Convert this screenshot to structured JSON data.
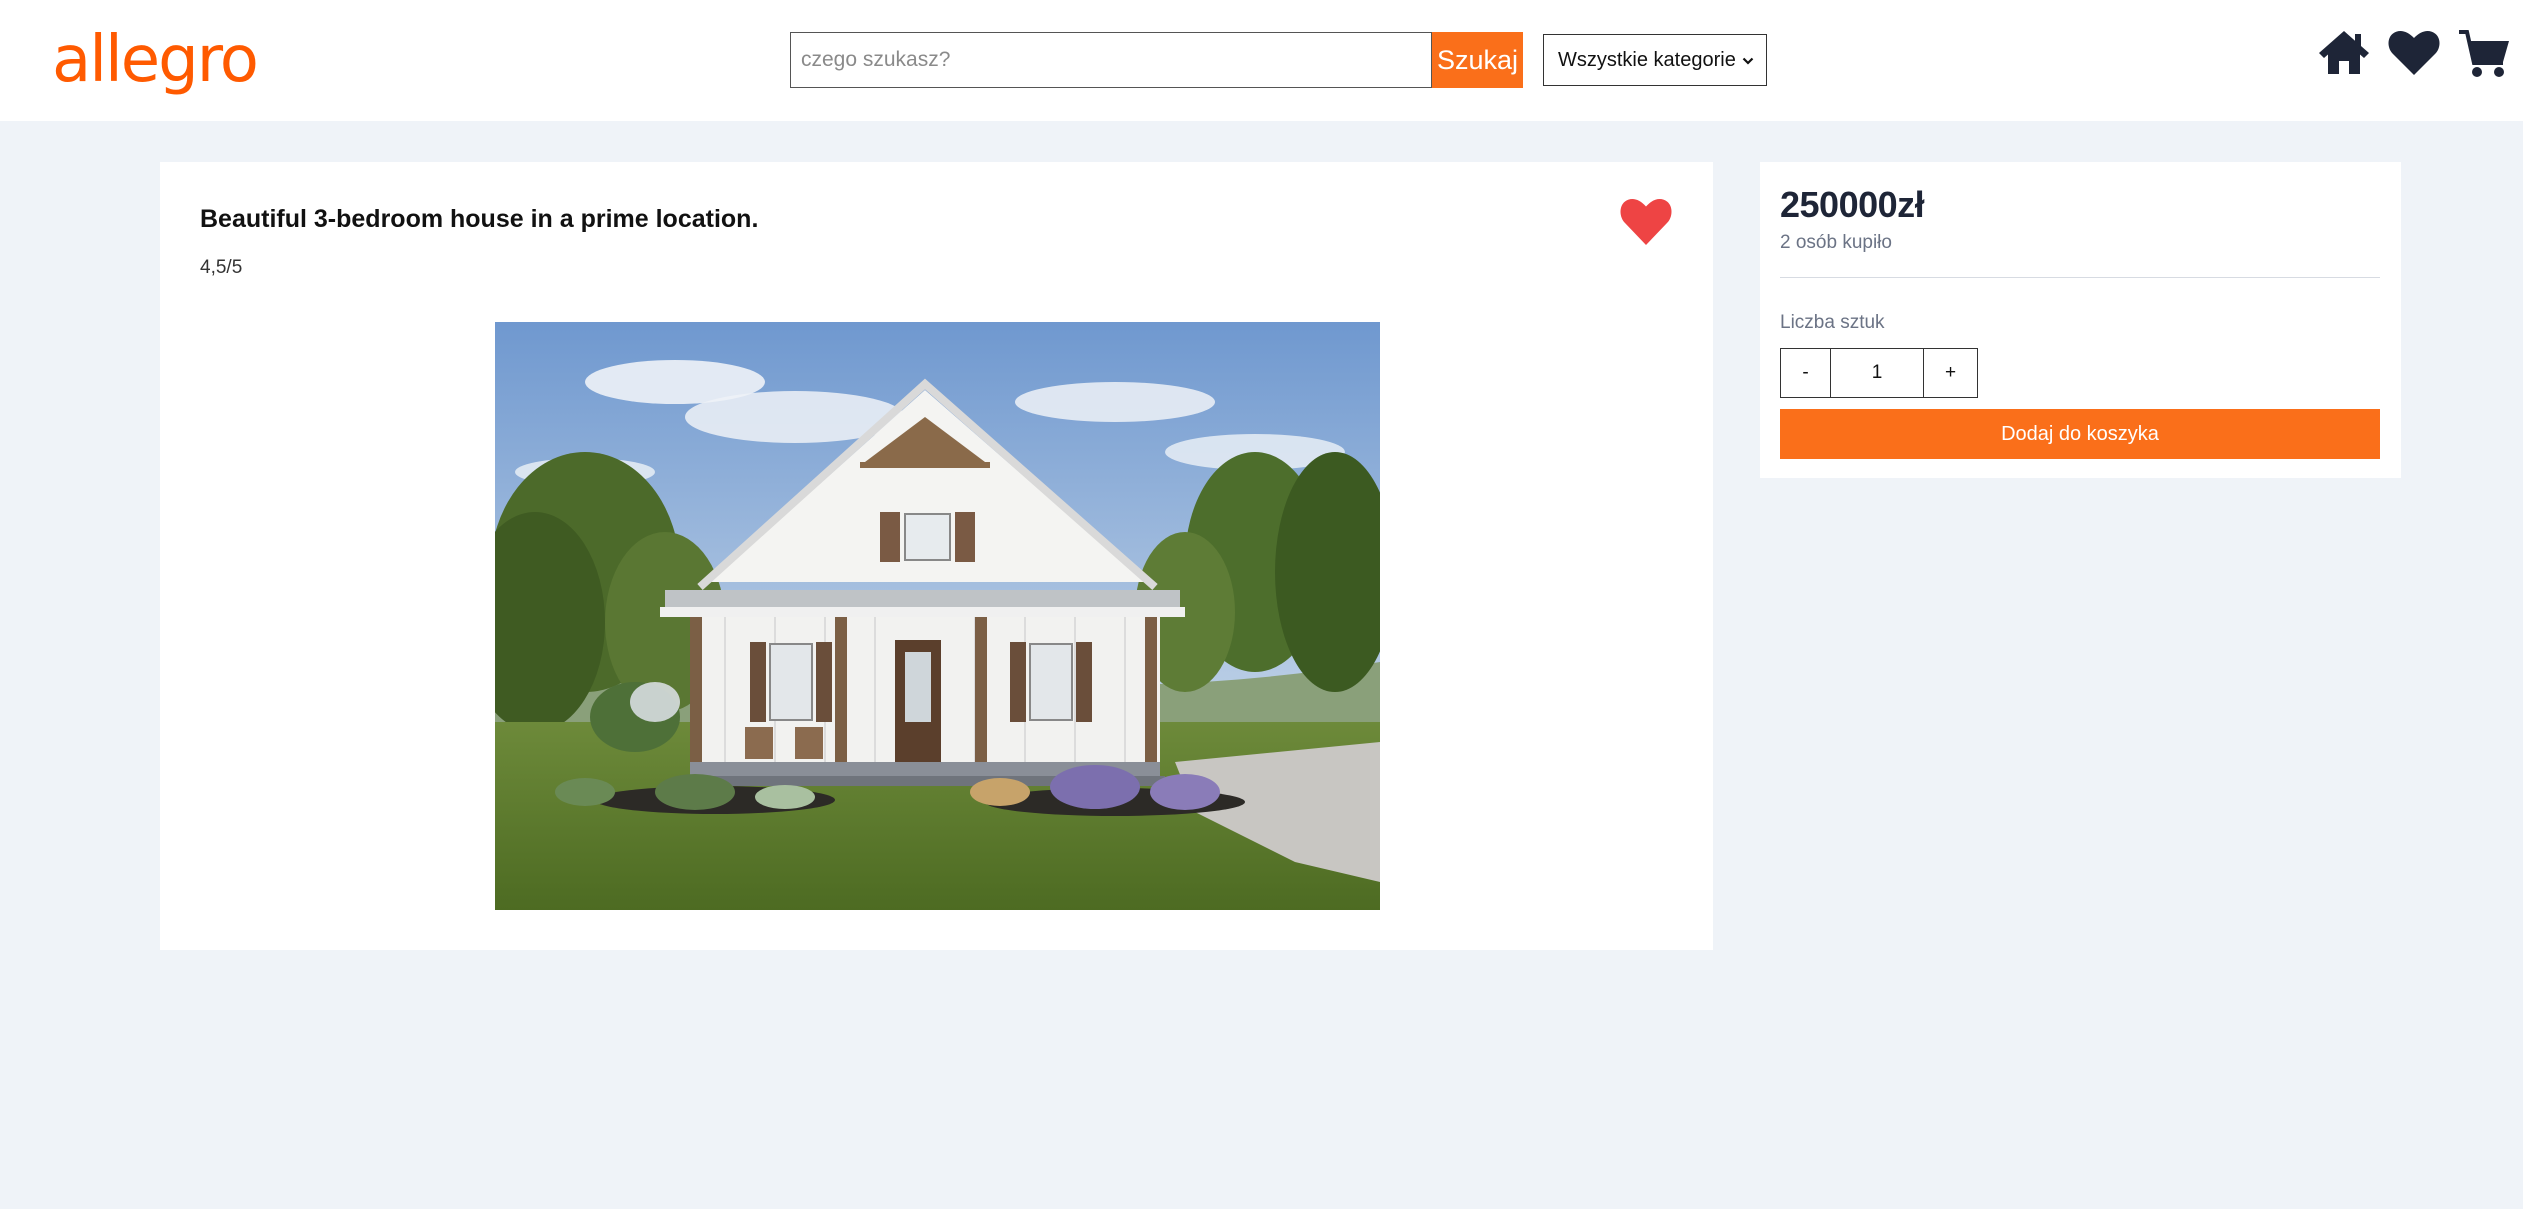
{
  "header": {
    "logo_text": "allegro",
    "search": {
      "placeholder": "czego szukasz?",
      "value": ""
    },
    "search_button_label": "Szukaj",
    "category_select_label": "Wszystkie kategorie",
    "icons": [
      "home-icon",
      "heart-icon",
      "cart-icon"
    ]
  },
  "product": {
    "title": "Beautiful 3-bedroom house in a prime location.",
    "rating": "4,5/5",
    "favorite_icon": "heart-icon"
  },
  "buy_box": {
    "price": "250000zł",
    "buyers": "2 osób kupiło",
    "quantity_label": "Liczba sztuk",
    "minus_label": "-",
    "quantity_value": "1",
    "plus_label": "+",
    "add_to_cart_label": "Dodaj do koszyka"
  },
  "colors": {
    "brand": "#ff5a00",
    "accent": "#fa6f1a",
    "page_background": "#eff3f8",
    "heart_red": "#ee4444",
    "icon_dark": "#1e2537"
  }
}
